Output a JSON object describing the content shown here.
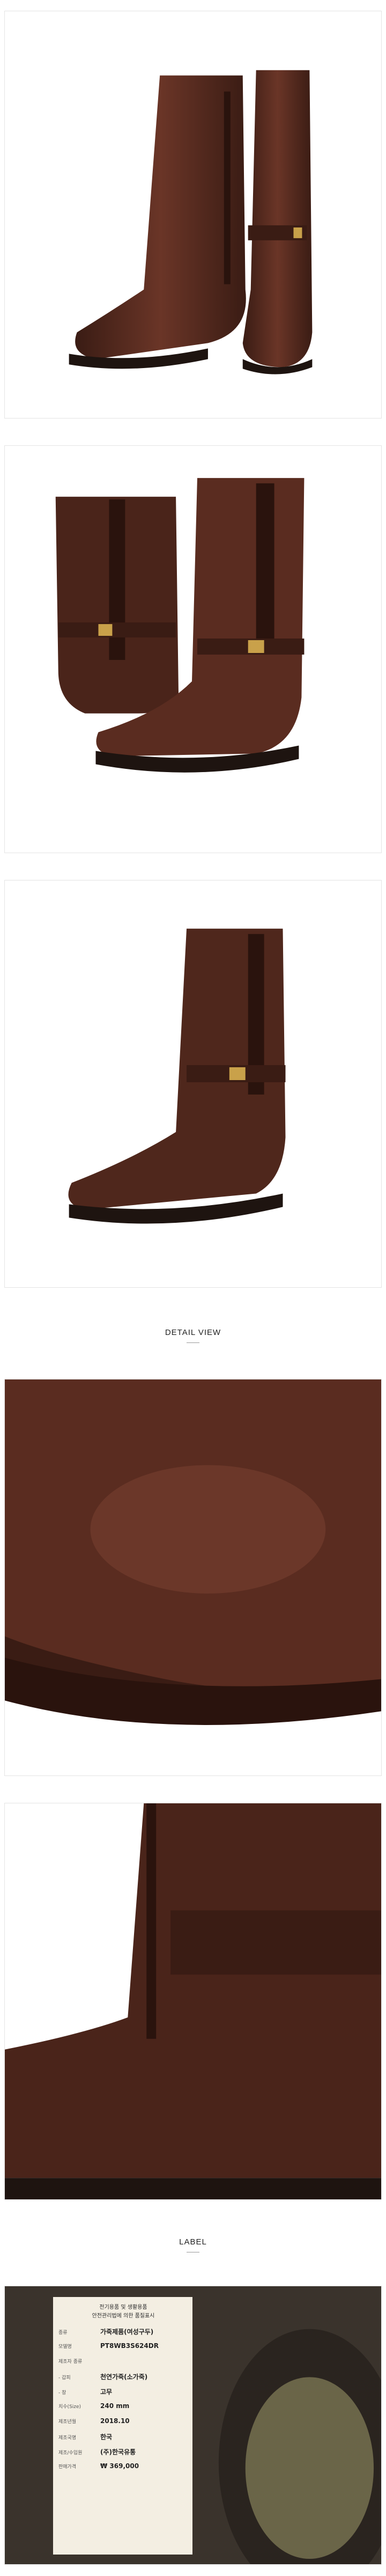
{
  "sections": {
    "detail_view": "DETAIL VIEW",
    "label": "LABEL"
  },
  "label_card": {
    "title_line1": "전기용품 및 생활용품",
    "title_line2": "안전관리법에 의한 품질표시",
    "rows": [
      {
        "key": "종류",
        "value": "가죽제품(여성구두)"
      },
      {
        "key": "모델명",
        "value": "PT8WB3S624DR"
      },
      {
        "key": "제조자 종류",
        "value": ""
      },
      {
        "key": "- 갑피",
        "value": "천연가죽(소가죽)"
      },
      {
        "key": "- 창",
        "value": "고무"
      },
      {
        "key": "치수(Size)",
        "value": "240 mm"
      },
      {
        "key": "제조년월",
        "value": "2018.10"
      },
      {
        "key": "제조국명",
        "value": "한국"
      },
      {
        "key": "제조/수입원",
        "value": "(주)한국유통"
      },
      {
        "key": "판매가격",
        "value": "₩ 369,000"
      }
    ]
  },
  "colors": {
    "leather": "#4a241a",
    "leather_light": "#7a4232",
    "sole": "#1e1410",
    "buckle": "#c9a14a",
    "label_bg": "#f3eee2"
  }
}
